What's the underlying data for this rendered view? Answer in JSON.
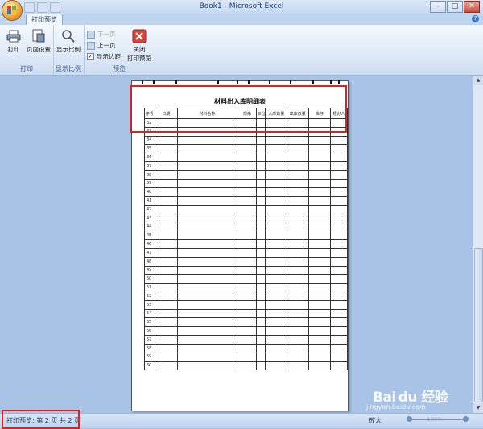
{
  "window": {
    "title": "Book1 - Microsoft Excel"
  },
  "ribbon": {
    "tab": "打印预览",
    "groups": {
      "print": "打印",
      "zoom": "显示比例",
      "preview": "预览"
    },
    "buttons": {
      "print": "打印",
      "page_setup": "页面设置",
      "zoom": "显示比例",
      "next_page": "下一页",
      "prev_page": "上一页",
      "show_margins": "显示边距",
      "close_preview_1": "关闭",
      "close_preview_2": "打印预览"
    },
    "show_margins_checked": true
  },
  "sheet": {
    "title": "材料出入库明细表",
    "columns": [
      "序号",
      "日期",
      "材料名称",
      "规格",
      "单位",
      "入库数量",
      "出库数量",
      "库存",
      "经办人"
    ],
    "rows": [
      "32",
      "33",
      "34",
      "35",
      "36",
      "37",
      "38",
      "39",
      "40",
      "41",
      "42",
      "43",
      "44",
      "45",
      "46",
      "47",
      "48",
      "49",
      "50",
      "51",
      "52",
      "53",
      "54",
      "55",
      "56",
      "57",
      "58",
      "59",
      "60"
    ]
  },
  "status": {
    "text": "打印预览: 第 2 页  共 2 页",
    "zoom_label": "放大",
    "zoom_value": "100%"
  },
  "watermark": {
    "logo": "Bai du 经验",
    "url": "jingyan.baidu.com"
  }
}
